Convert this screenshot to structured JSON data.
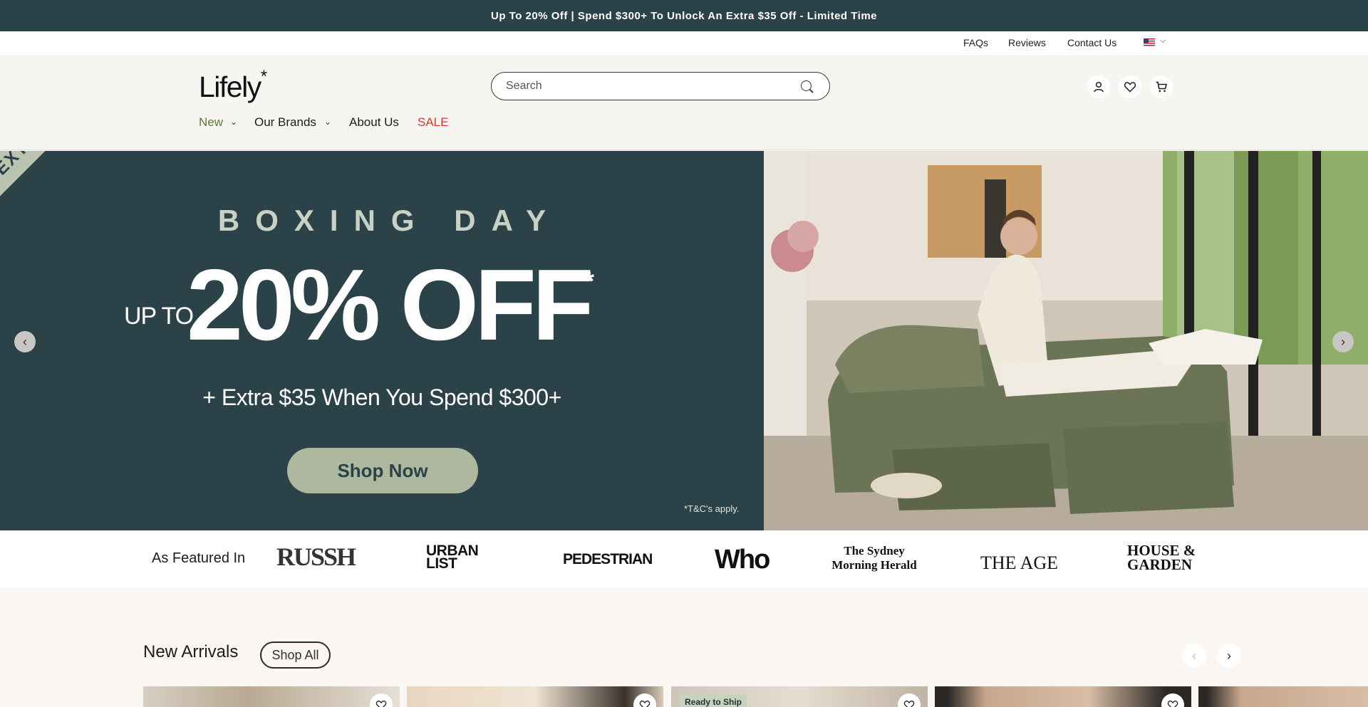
{
  "announcement": "Up To 20% Off | Spend $300+ To Unlock An Extra $35 Off - Limited Time",
  "utility_links": [
    "FAQs",
    "Reviews",
    "Contact Us"
  ],
  "brand": {
    "name": "Lifely",
    "mark": "*"
  },
  "search": {
    "placeholder": "Search"
  },
  "nav": [
    {
      "label": "New"
    },
    {
      "label": "Our Brands"
    },
    {
      "label": "About Us"
    },
    {
      "label": "SALE"
    }
  ],
  "hero": {
    "ribbon": "ED! • EXTENDED! • EX",
    "eyebrow": "BOXING DAY",
    "up_to": "UP TO",
    "headline": "20% OFF",
    "asterisk": "*",
    "subline": "+ Extra $35 When You Spend $300+",
    "cta": "Shop Now",
    "terms": "*T&C's apply."
  },
  "featured": {
    "title": "As Featured In",
    "publications": [
      "RUSSH",
      "URBAN LIST",
      "PEDESTRIAN",
      "Who",
      "The Sydney Morning Herald",
      "THE AGE",
      "HOUSE & GARDEN"
    ]
  },
  "new_arrivals": {
    "title": "New Arrivals",
    "shop_all": "Shop All",
    "badge": "Ready to Ship"
  },
  "colors": {
    "brand_dark": "#2b4249",
    "sage": "#adb89f",
    "sale_red": "#d33a2c",
    "new_green": "#5a7a3a"
  }
}
